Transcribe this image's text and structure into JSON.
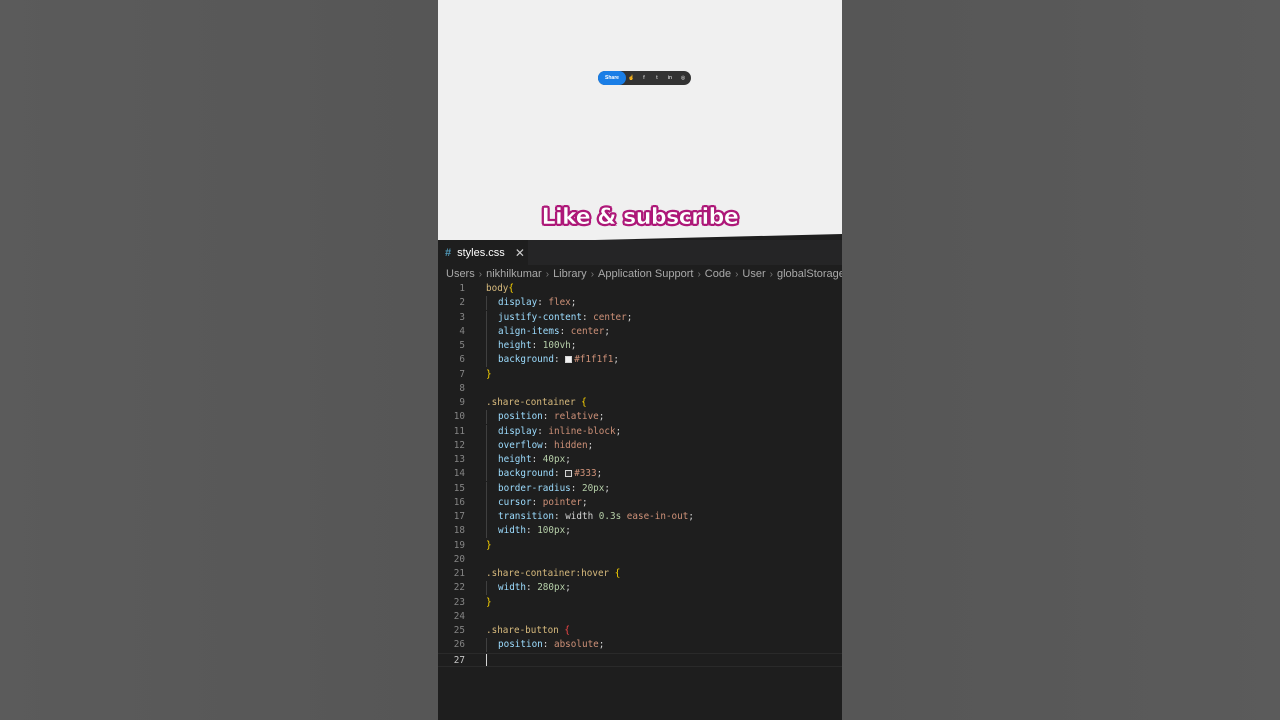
{
  "preview": {
    "share_label": "Share",
    "icons": [
      "cursor-hand-icon",
      "facebook-icon",
      "twitter-icon",
      "linkedin-icon",
      "instagram-icon"
    ],
    "icon_glyphs": [
      "☝",
      "f",
      "t",
      "in",
      "◎"
    ]
  },
  "caption": "Like & subscribe",
  "editor": {
    "tab": {
      "icon": "#",
      "label": "styles.css",
      "close": "✕"
    },
    "breadcrumb": [
      "Users",
      "nikhilkumar",
      "Library",
      "Application Support",
      "Code",
      "User",
      "globalStorage"
    ],
    "breadcrumb_sep": "›",
    "current_line": 27,
    "lines": [
      {
        "n": "1",
        "indent": 0,
        "tokens": [
          {
            "t": "body",
            "c": "sel"
          },
          {
            "t": "{",
            "c": "brc"
          }
        ]
      },
      {
        "n": "2",
        "indent": 1,
        "tokens": [
          {
            "t": "display",
            "c": "prop"
          },
          {
            "t": ": ",
            "c": "pun"
          },
          {
            "t": "flex",
            "c": "val"
          },
          {
            "t": ";",
            "c": "pun"
          }
        ]
      },
      {
        "n": "3",
        "indent": 1,
        "tokens": [
          {
            "t": "justify-content",
            "c": "prop"
          },
          {
            "t": ": ",
            "c": "pun"
          },
          {
            "t": "center",
            "c": "val"
          },
          {
            "t": ";",
            "c": "pun"
          }
        ]
      },
      {
        "n": "4",
        "indent": 1,
        "tokens": [
          {
            "t": "align-items",
            "c": "prop"
          },
          {
            "t": ": ",
            "c": "pun"
          },
          {
            "t": "center",
            "c": "val"
          },
          {
            "t": ";",
            "c": "pun"
          }
        ]
      },
      {
        "n": "5",
        "indent": 1,
        "tokens": [
          {
            "t": "height",
            "c": "prop"
          },
          {
            "t": ": ",
            "c": "pun"
          },
          {
            "t": "100vh",
            "c": "num"
          },
          {
            "t": ";",
            "c": "pun"
          }
        ]
      },
      {
        "n": "6",
        "indent": 1,
        "tokens": [
          {
            "t": "background",
            "c": "prop"
          },
          {
            "t": ": ",
            "c": "pun"
          },
          {
            "t": "",
            "c": "swatch",
            "color": "#f1f1f1"
          },
          {
            "t": "#f1f1f1",
            "c": "val"
          },
          {
            "t": ";",
            "c": "pun"
          }
        ]
      },
      {
        "n": "7",
        "indent": 0,
        "tokens": [
          {
            "t": "}",
            "c": "brc"
          }
        ]
      },
      {
        "n": "8",
        "indent": 0,
        "tokens": []
      },
      {
        "n": "9",
        "indent": 0,
        "tokens": [
          {
            "t": ".share-container ",
            "c": "sel"
          },
          {
            "t": "{",
            "c": "brc"
          }
        ]
      },
      {
        "n": "10",
        "indent": 1,
        "tokens": [
          {
            "t": "position",
            "c": "prop"
          },
          {
            "t": ": ",
            "c": "pun"
          },
          {
            "t": "relative",
            "c": "val"
          },
          {
            "t": ";",
            "c": "pun"
          }
        ]
      },
      {
        "n": "11",
        "indent": 1,
        "tokens": [
          {
            "t": "display",
            "c": "prop"
          },
          {
            "t": ": ",
            "c": "pun"
          },
          {
            "t": "inline-block",
            "c": "val"
          },
          {
            "t": ";",
            "c": "pun"
          }
        ]
      },
      {
        "n": "12",
        "indent": 1,
        "tokens": [
          {
            "t": "overflow",
            "c": "prop"
          },
          {
            "t": ": ",
            "c": "pun"
          },
          {
            "t": "hidden",
            "c": "val"
          },
          {
            "t": ";",
            "c": "pun"
          }
        ]
      },
      {
        "n": "13",
        "indent": 1,
        "tokens": [
          {
            "t": "height",
            "c": "prop"
          },
          {
            "t": ": ",
            "c": "pun"
          },
          {
            "t": "40px",
            "c": "num"
          },
          {
            "t": ";",
            "c": "pun"
          }
        ]
      },
      {
        "n": "14",
        "indent": 1,
        "tokens": [
          {
            "t": "background",
            "c": "prop"
          },
          {
            "t": ": ",
            "c": "pun"
          },
          {
            "t": "",
            "c": "swatch",
            "color": "#333333"
          },
          {
            "t": "#333",
            "c": "val"
          },
          {
            "t": ";",
            "c": "pun"
          }
        ]
      },
      {
        "n": "15",
        "indent": 1,
        "tokens": [
          {
            "t": "border-radius",
            "c": "prop"
          },
          {
            "t": ": ",
            "c": "pun"
          },
          {
            "t": "20px",
            "c": "num"
          },
          {
            "t": ";",
            "c": "pun"
          }
        ]
      },
      {
        "n": "16",
        "indent": 1,
        "tokens": [
          {
            "t": "cursor",
            "c": "prop"
          },
          {
            "t": ": ",
            "c": "pun"
          },
          {
            "t": "pointer",
            "c": "val"
          },
          {
            "t": ";",
            "c": "pun"
          }
        ]
      },
      {
        "n": "17",
        "indent": 1,
        "tokens": [
          {
            "t": "transition",
            "c": "prop"
          },
          {
            "t": ": ",
            "c": "pun"
          },
          {
            "t": "width ",
            "c": "pun"
          },
          {
            "t": "0.3s",
            "c": "num"
          },
          {
            "t": " ",
            "c": "pun"
          },
          {
            "t": "ease-in-out",
            "c": "val"
          },
          {
            "t": ";",
            "c": "pun"
          }
        ]
      },
      {
        "n": "18",
        "indent": 1,
        "tokens": [
          {
            "t": "width",
            "c": "prop"
          },
          {
            "t": ": ",
            "c": "pun"
          },
          {
            "t": "100px",
            "c": "num"
          },
          {
            "t": ";",
            "c": "pun"
          }
        ]
      },
      {
        "n": "19",
        "indent": 0,
        "tokens": [
          {
            "t": "}",
            "c": "brc"
          }
        ]
      },
      {
        "n": "20",
        "indent": 0,
        "tokens": []
      },
      {
        "n": "21",
        "indent": 0,
        "tokens": [
          {
            "t": ".share-container:hover ",
            "c": "sel"
          },
          {
            "t": "{",
            "c": "brc"
          }
        ]
      },
      {
        "n": "22",
        "indent": 1,
        "tokens": [
          {
            "t": "width",
            "c": "prop"
          },
          {
            "t": ": ",
            "c": "pun"
          },
          {
            "t": "280px",
            "c": "num"
          },
          {
            "t": ";",
            "c": "pun"
          }
        ]
      },
      {
        "n": "23",
        "indent": 0,
        "tokens": [
          {
            "t": "}",
            "c": "brc"
          }
        ]
      },
      {
        "n": "24",
        "indent": 0,
        "tokens": []
      },
      {
        "n": "25",
        "indent": 0,
        "tokens": [
          {
            "t": ".share-button ",
            "c": "sel"
          },
          {
            "t": "{",
            "c": "bad"
          }
        ]
      },
      {
        "n": "26",
        "indent": 1,
        "tokens": [
          {
            "t": "position",
            "c": "prop"
          },
          {
            "t": ": ",
            "c": "pun"
          },
          {
            "t": "absolute",
            "c": "val"
          },
          {
            "t": ";",
            "c": "pun"
          }
        ]
      },
      {
        "n": "27",
        "indent": 0,
        "tokens": [
          {
            "t": "",
            "c": "caret"
          }
        ]
      }
    ]
  },
  "colors": {
    "share_blue": "#1a7ee6",
    "caption_outline": "#b0177a",
    "editor_bg": "#1e1e1e",
    "preview_bg": "#f0f0f0"
  }
}
